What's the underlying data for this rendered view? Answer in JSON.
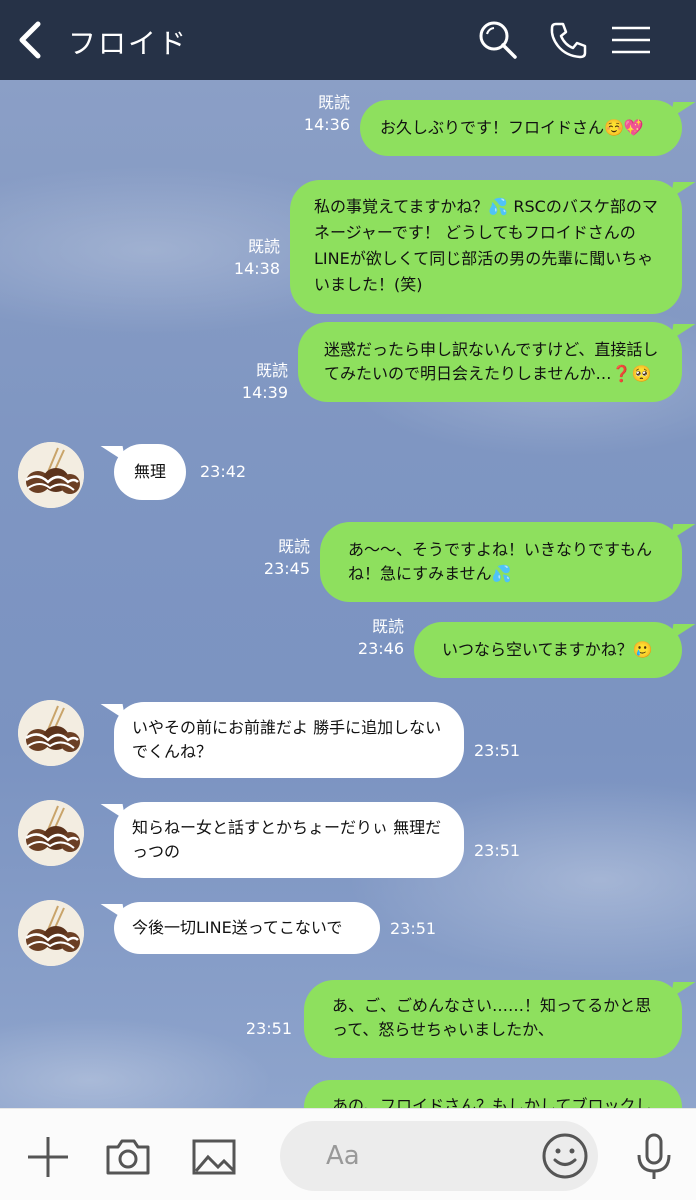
{
  "header": {
    "title": "フロイド",
    "icons": [
      "back-icon",
      "search-icon",
      "phone-icon",
      "menu-icon"
    ]
  },
  "messages": [
    {
      "side": "out",
      "text": "お久しぶりです！フロイドさん☺️💖",
      "read": "既読",
      "time": "14:36"
    },
    {
      "side": "out",
      "text": "私の事覚えてますかね？💦 RSCのバスケ部のマネージャーです！ どうしてもフロイドさんのLINEが欲しくて同じ部活の男の先輩に聞いちゃいました！(笑)",
      "read": "既読",
      "time": "14:38"
    },
    {
      "side": "out",
      "text": "迷惑だったら申し訳ないんですけど、直接話してみたいので明日会えたりしませんか…❓🥺",
      "read": "既読",
      "time": "14:39"
    },
    {
      "side": "in",
      "text": "無理",
      "time": "23:42"
    },
    {
      "side": "out",
      "text": "あ〜〜、そうですよね！いきなりですもんね！急にすみません💦",
      "read": "既読",
      "time": "23:45"
    },
    {
      "side": "out",
      "text": "いつなら空いてますかね？🥲",
      "read": "既読",
      "time": "23:46"
    },
    {
      "side": "in",
      "text": "いやその前にお前誰だよ 勝手に追加しないでくんね？",
      "time": "23:51"
    },
    {
      "side": "in",
      "text": "知らねー女と話すとかちょーだりぃ 無理だっつの",
      "time": "23:51"
    },
    {
      "side": "in",
      "text": "今後一切LINE送ってこないで",
      "time": "23:51"
    },
    {
      "side": "out",
      "text": "あ、ご、ごめんなさい……！知ってるかと思って、怒らせちゃいましたか、",
      "time": "23:51"
    },
    {
      "side": "out",
      "text": "あの、フロイドさん？もしかしてブロックし"
    }
  ],
  "footer": {
    "placeholder": "Aa",
    "icons": [
      "plus-icon",
      "camera-icon",
      "image-icon",
      "smile-icon",
      "mic-icon"
    ]
  },
  "colors": {
    "header_bg": "#263247",
    "outgoing_bubble": "#8ee05e",
    "incoming_bubble": "#ffffff",
    "chat_bg": "#8da2c8"
  }
}
